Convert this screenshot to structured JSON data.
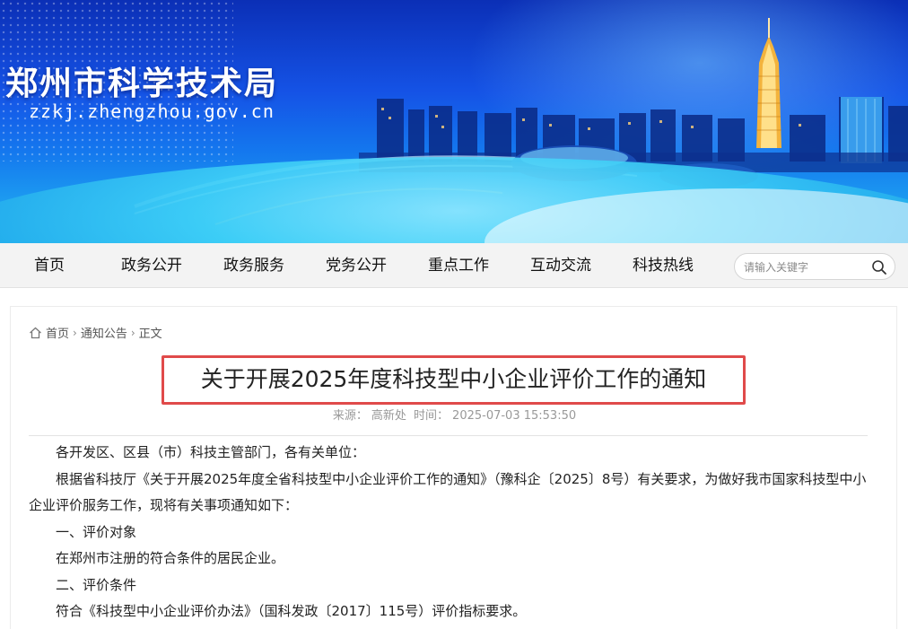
{
  "header": {
    "site_title": "郑州市科学技术局",
    "site_domain": "zzkj.zhengzhou.gov.cn"
  },
  "nav": {
    "items": [
      {
        "label": "首页"
      },
      {
        "label": "政务公开"
      },
      {
        "label": "政务服务"
      },
      {
        "label": "党务公开"
      },
      {
        "label": "重点工作"
      },
      {
        "label": "互动交流"
      },
      {
        "label": "科技热线"
      }
    ],
    "search_placeholder": "请输入关键字"
  },
  "breadcrumb": {
    "home": "首页",
    "section": "通知公告",
    "current": "正文"
  },
  "article": {
    "title": "关于开展2025年度科技型中小企业评价工作的通知",
    "source_label": "来源：",
    "source": "高新处",
    "time_label": "时间：",
    "time": "2025-07-03 15:53:50",
    "paragraphs": [
      "各开发区、区县（市）科技主管部门，各有关单位：",
      "根据省科技厅《关于开展2025年度全省科技型中小企业评价工作的通知》（豫科企〔2025〕8号）有关要求，为做好我市国家科技型中小企业评价服务工作，现将有关事项通知如下：",
      "一、评价对象",
      "在郑州市注册的符合条件的居民企业。",
      "二、评价条件",
      "符合《科技型中小企业评价办法》（国科发政〔2017〕115号）评价指标要求。"
    ]
  },
  "colors": {
    "title_highlight_border": "#e04a4a",
    "banner_blue": "#1553e6",
    "nav_background": "#f3f3f3"
  }
}
